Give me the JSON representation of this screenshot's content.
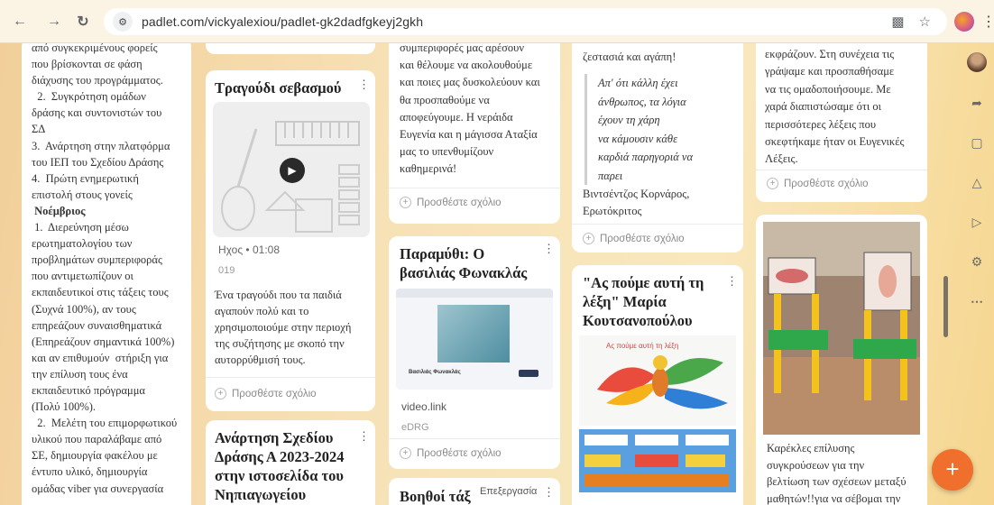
{
  "browser": {
    "url": "padlet.com/vickyalexiou/padlet-gk2dadfgkeyj2gkh"
  },
  "col1": {
    "lines": [
      "από συγκεκριμένους φορείς",
      "που βρίσκονται σε φάση",
      "διάχυσης του προγράμματος.",
      "  2.  Συγκρότηση ομάδων",
      "δράσης και συντονιστών του",
      "ΣΔ",
      "3.  Ανάρτηση στην πλατφόρμα",
      "του ΙΕΠ του Σχεδίου Δράσης",
      "4.  Πρώτη ενημερωτική",
      "επιστολή στους γονείς",
      " Νοέμβριος",
      " 1.  Διερεύνηση μέσω",
      "ερωτηματολογίου των",
      "προβλημάτων συμπεριφοράς",
      "που αντιμετωπίζουν οι",
      "εκπαιδευτικοί στις τάξεις τους",
      "(Συχνά 100%), αν τους",
      "επηρεάζουν συναισθηματικά",
      "(Επηρεάζουν σημαντικά 100%)",
      "και αν επιθυμούν  στήριξη για",
      "την επίλυση τους ένα",
      "εκπαιδευτικό πρόγραμμα",
      "(Πολύ 100%).",
      "  2.  Μελέτη του επιμορφωτικού",
      "υλικού που παραλάβαμε από",
      "ΣΕ, δημιουργία φακέλου με",
      "έντυπο υλικό, δημιουργία",
      "ομάδας viber για συνεργασία"
    ]
  },
  "song_card": {
    "title": "Τραγούδι σεβασμού",
    "meta": "Ηχος • 01:08",
    "code": "019",
    "body": [
      "Ένα τραγούδι που τα παιδιά",
      "αγαπούν πολύ και το",
      "χρησιμοποιούμε στην περιοχή",
      "της συζήτησης με σκοπό την",
      "αυτορρύθμισή τους."
    ],
    "comment": "Προσθέστε σχόλιο"
  },
  "plan_card": {
    "title": "Ανάρτηση Σχεδίου Δράσης Α 2023-2024 στην ιστοσελίδα του Νηπιαγωγείου"
  },
  "col3_top": {
    "body": [
      "συμπεριφορές μας αρέσουν",
      "και θέλουμε να ακολουθούμε",
      "και ποιες μας δυσκολεύουν και",
      "θα προσπαθούμε να",
      "αποφεύγουμε. Η νεράιδα",
      "Ευγενία και η μάγισσα Αταξία",
      "μας το υπενθυμίζουν",
      "καθημερινά!"
    ],
    "comment": "Προσθέστε σχόλιο"
  },
  "fairy_card": {
    "title": "Παραμύθι: Ο βασιλιάς Φωνακλάς",
    "preview_caption": "Βασιλιάς Φωνακλάς",
    "link": "video.link",
    "code": "eDRG",
    "comment": "Προσθέστε σχόλιο"
  },
  "helpers_card": {
    "title": "Βοηθοί τάξ",
    "edit": "Επεξεργασία"
  },
  "poem_card": {
    "intro": "ζεστασιά και αγάπη!",
    "quote": [
      "Απ' ότι κάλλη έχει",
      "άνθρωπος, τα λόγια",
      "έχουν τη χάρη",
      "να κάμουσιν κάθε",
      "καρδιά παρηγοριά να",
      "παρει"
    ],
    "author": "Βιντσέντζος Κορνάρος,",
    "work": "Ερωτόκριτος",
    "comment": "Προσθέστε σχόλιο"
  },
  "word_card": {
    "title": "\"Ας πούμε αυτή τη λέξη\" Μαρία Κουτσανοπούλου"
  },
  "col5_top": {
    "body": [
      "εκφράζουν. Στη συνέχεια τις",
      "γράψαμε και προσπαθήσαμε",
      "να τις ομαδοποιήσουμε. Με",
      "χαρά διαπιστώσαμε ότι οι",
      "περισσότερες λέξεις που",
      "σκεφτήκαμε ήταν οι Ευγενικές",
      "Λέξεις."
    ],
    "comment": "Προσθέστε σχόλιο"
  },
  "chairs_card": {
    "body": [
      "Καρέκλες επίλυσης",
      "συγκρούσεων για την",
      "βελτίωση των σχέσεων μεταξύ",
      "μαθητών!!για να σέβομαι την"
    ]
  },
  "fab": {
    "label": "+"
  }
}
